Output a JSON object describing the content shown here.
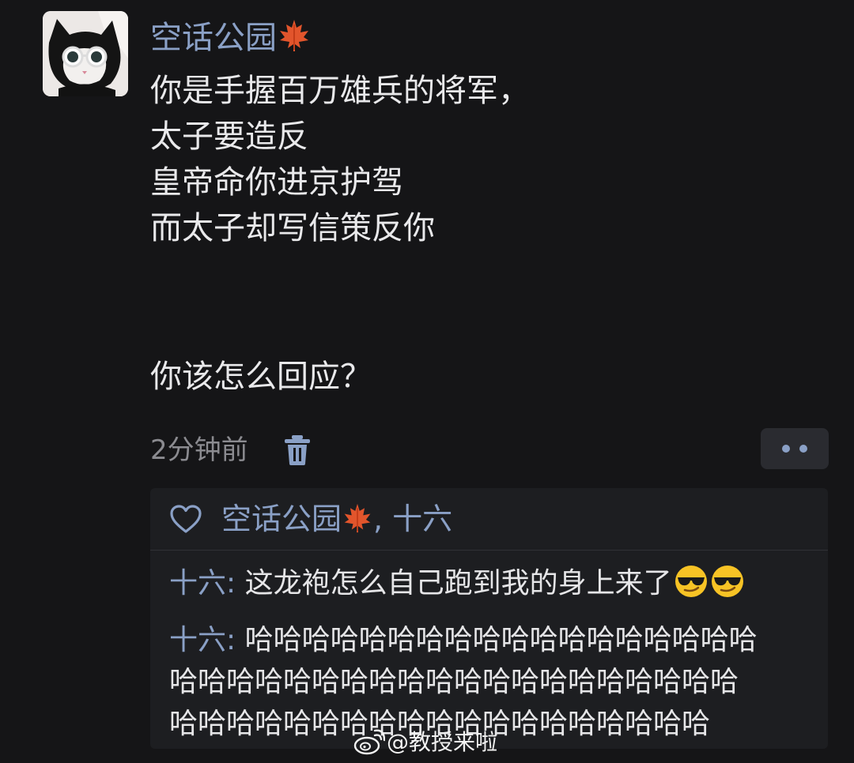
{
  "post": {
    "author": "空话公园",
    "author_emoji_icon": "maple-leaf-icon",
    "lines": [
      "你是手握百万雄兵的将军，",
      "太子要造反",
      "皇帝命你进京护驾",
      "而太子却写信策反你",
      "你该怎么回应？"
    ],
    "time": "2分钟前",
    "delete_icon": "trash-icon",
    "more_icon": "more-dots-icon"
  },
  "likes": {
    "icon": "heart-icon",
    "text": ", 十六"
  },
  "comments": [
    {
      "author": "十六",
      "separator": ": ",
      "text": "这龙袍怎么自己跑到我的身上来了",
      "emoji_icons": [
        "sunglasses-smirk-emoji",
        "sunglasses-smirk-emoji"
      ]
    },
    {
      "author": "十六",
      "separator": ": ",
      "text": "哈哈哈哈哈哈哈哈哈哈哈哈哈哈哈哈哈哈哈哈哈哈哈哈哈哈哈哈哈哈哈哈哈哈哈哈哈哈哈哈哈哈哈哈哈哈哈哈哈哈",
      "lines": [
        "哈哈哈哈哈哈哈哈哈哈哈哈哈哈哈哈哈哈",
        "哈哈哈哈哈哈哈哈哈哈哈哈哈哈哈哈哈哈哈哈",
        "哈哈哈哈哈哈哈哈哈哈哈哈哈哈哈哈哈哈哈"
      ]
    }
  ],
  "watermark": {
    "icon": "weibo-logo-icon",
    "text": "@教授来啦"
  },
  "colors": {
    "background": "#151517",
    "accent_blue": "#8aa0c6",
    "comment_panel": "#1d1e21",
    "muted_text": "#8b8b90"
  }
}
